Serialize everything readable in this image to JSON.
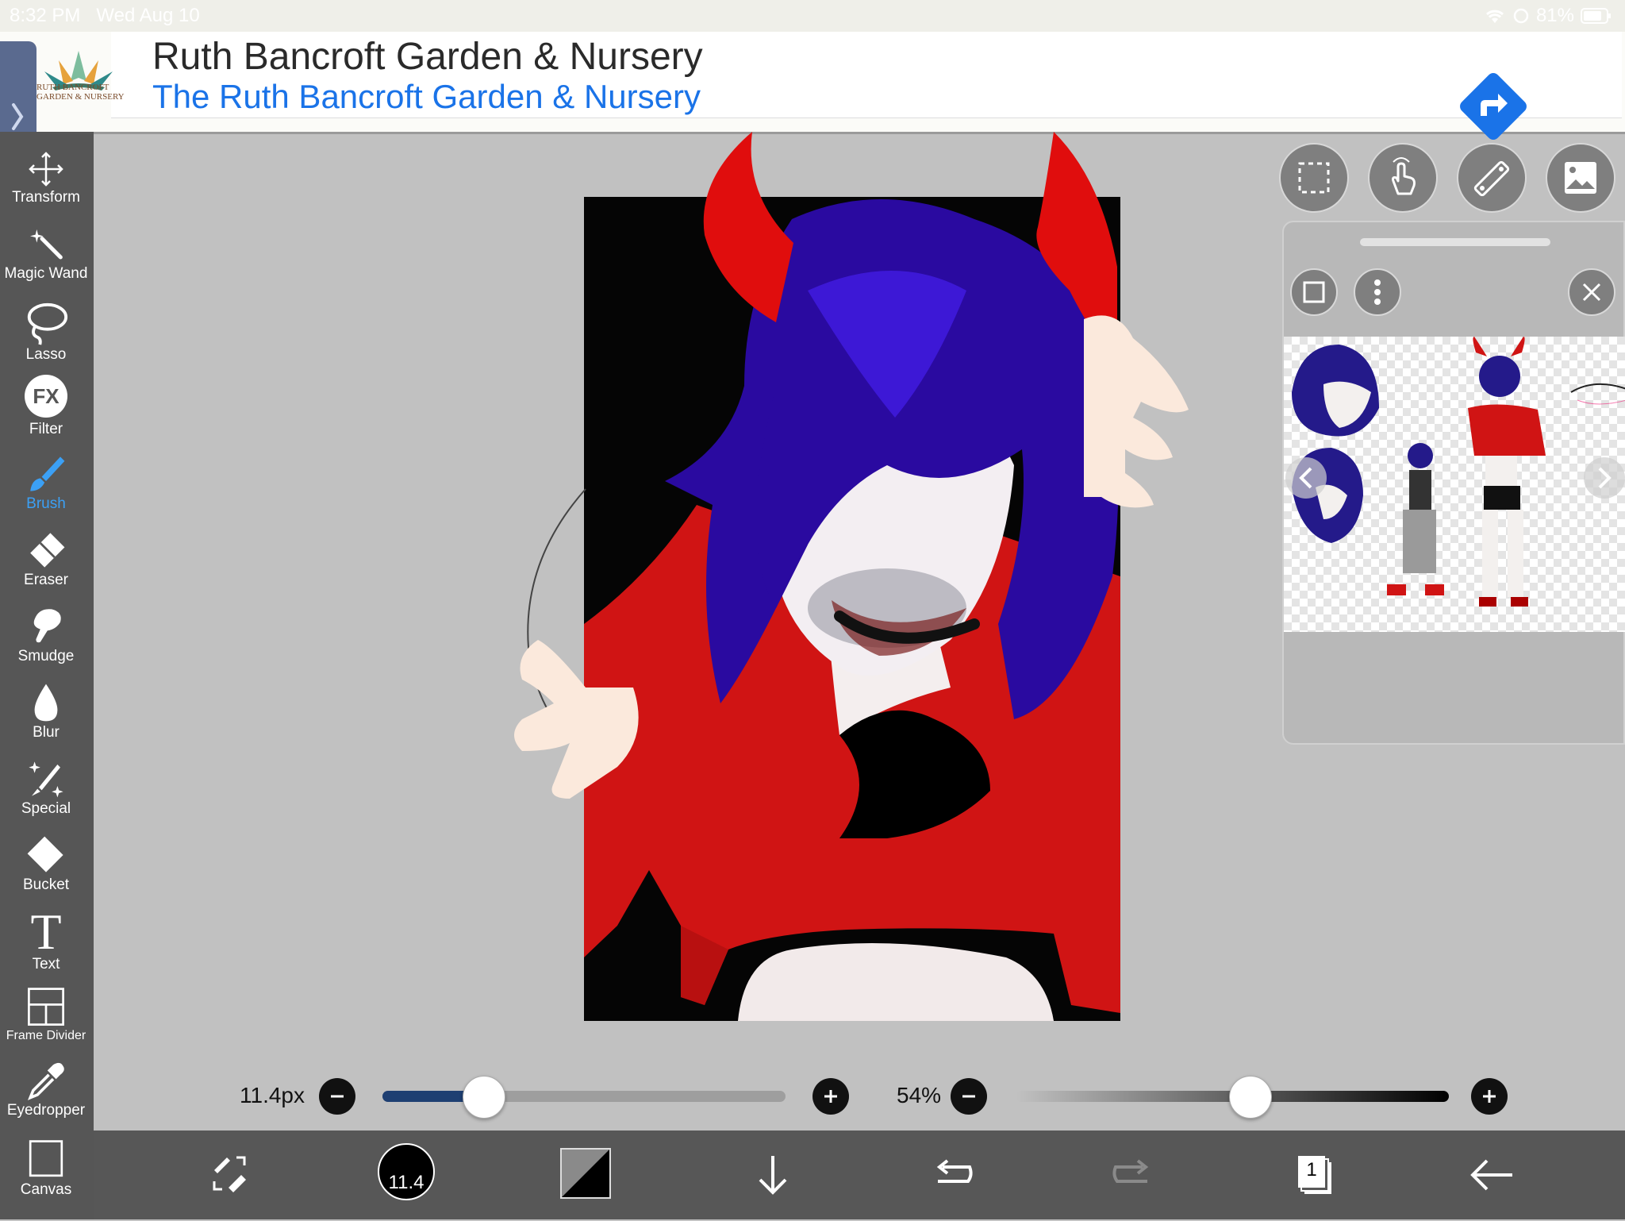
{
  "status": {
    "time": "8:32 PM",
    "date": "Wed Aug 10",
    "battery": "81%"
  },
  "ad": {
    "logo_line1": "RUTH BANCROFT",
    "logo_line2": "GARDEN & NURSERY",
    "title": "Ruth Bancroft Garden & Nursery",
    "subtitle": "The Ruth Bancroft Garden & Nursery"
  },
  "tools": [
    {
      "label": "Transform",
      "icon": "transform-icon"
    },
    {
      "label": "Magic Wand",
      "icon": "magic-wand-icon"
    },
    {
      "label": "Lasso",
      "icon": "lasso-icon"
    },
    {
      "label": "Filter",
      "icon": "fx-icon",
      "glyph": "FX"
    },
    {
      "label": "Brush",
      "icon": "brush-icon"
    },
    {
      "label": "Eraser",
      "icon": "eraser-icon"
    },
    {
      "label": "Smudge",
      "icon": "smudge-icon"
    },
    {
      "label": "Blur",
      "icon": "blur-icon"
    },
    {
      "label": "Special",
      "icon": "special-icon"
    },
    {
      "label": "Bucket",
      "icon": "bucket-icon"
    },
    {
      "label": "Text",
      "icon": "text-icon",
      "glyph": "T"
    },
    {
      "label": "Frame Divider",
      "icon": "frame-divider-icon"
    },
    {
      "label": "Eyedropper",
      "icon": "eyedropper-icon"
    },
    {
      "label": "Canvas",
      "icon": "canvas-icon"
    }
  ],
  "active_tool": "Brush",
  "brush_size": {
    "label": "11.4px",
    "value": 11.4,
    "fraction": 0.25
  },
  "opacity": {
    "label": "54%",
    "value": 54,
    "fraction": 0.54
  },
  "bottom": {
    "brush_indicator": "11.4",
    "layer_count": "1"
  },
  "colors": {
    "accent": "#3ba0f5",
    "toolbar": "#565656",
    "primary": "#000000"
  }
}
